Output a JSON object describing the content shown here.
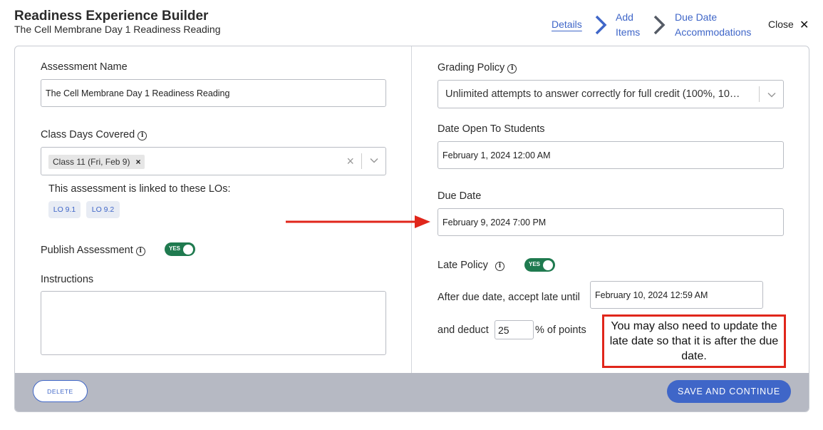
{
  "header": {
    "title": "Readiness Experience Builder",
    "subtitle": "The Cell Membrane Day 1 Readiness Reading"
  },
  "steps": {
    "details": "Details",
    "add_items_1": "Add",
    "add_items_2": "Items",
    "due_date_1": "Due Date",
    "due_date_2": "Accommodations",
    "close": "Close",
    "close_icon": "✕"
  },
  "left": {
    "assessment_name_label": "Assessment Name",
    "assessment_name_value": "The Cell Membrane Day 1 Readiness Reading",
    "class_days_label": "Class Days Covered",
    "class_day_chip": "Class 11 (Fri, Feb 9)",
    "linked_los_text": "This assessment is linked to these LOs:",
    "lo_tags": [
      "LO 9.1",
      "LO 9.2"
    ],
    "publish_label": "Publish Assessment",
    "publish_toggle": "YES",
    "instructions_label": "Instructions",
    "instructions_value": ""
  },
  "right": {
    "grading_policy_label": "Grading Policy",
    "grading_policy_value": "Unlimited attempts to answer correctly for full credit (100%, 10…",
    "date_open_label": "Date Open To Students",
    "date_open_value": "February 1, 2024 12:00 AM",
    "due_date_label": "Due Date",
    "due_date_value": "February 9, 2024 7:00 PM",
    "late_policy_label": "Late Policy",
    "late_policy_toggle": "YES",
    "accept_late_label": "After due date, accept late until",
    "accept_late_value": "February 10, 2024 12:59 AM",
    "deduct_label": "and deduct",
    "deduct_value": "25",
    "deduct_suffix": "% of points"
  },
  "footer": {
    "delete_label": "DELETE",
    "save_label": "SAVE AND CONTINUE"
  },
  "annotation": {
    "callout_text": "You may also need to update the late date so that it is after the due date.",
    "color": "#e0261b"
  },
  "colors": {
    "accent": "#3f66c8",
    "toggle_on": "#1f7a4f",
    "footer_bg": "#b6b9c3"
  }
}
